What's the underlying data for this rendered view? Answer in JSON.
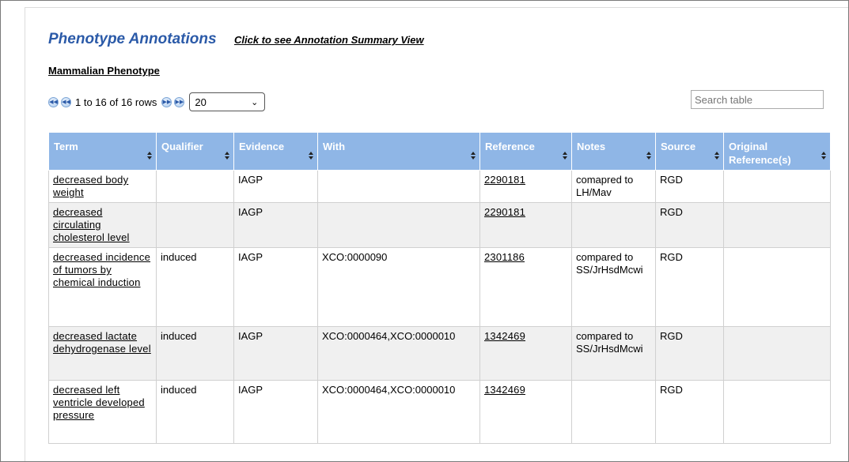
{
  "header": {
    "title": "Phenotype Annotations",
    "summary_link": "Click to see Annotation Summary View"
  },
  "subsection": {
    "title": "Mammalian Phenotype"
  },
  "pager": {
    "rows_text": "1 to 16 of 16 rows",
    "page_size": "20",
    "icons": [
      "first-page-icon",
      "prev-page-icon",
      "next-page-icon",
      "last-page-icon"
    ]
  },
  "search": {
    "placeholder": "Search table"
  },
  "table": {
    "columns": [
      "Term",
      "Qualifier",
      "Evidence",
      "With",
      "Reference",
      "Notes",
      "Source",
      "Original Reference(s)"
    ],
    "rows": [
      {
        "term": "decreased body weight",
        "qualifier": "",
        "evidence": "IAGP",
        "with": "",
        "reference": "2290181",
        "notes": "comapred to LH/Mav",
        "source": "RGD",
        "original": ""
      },
      {
        "term": "decreased circulating cholesterol level",
        "qualifier": "",
        "evidence": "IAGP",
        "with": "",
        "reference": "2290181",
        "notes": "",
        "source": "RGD",
        "original": ""
      },
      {
        "term": "decreased incidence of tumors by chemical induction",
        "qualifier": "induced",
        "evidence": "IAGP",
        "with": "XCO:0000090",
        "reference": "2301186",
        "notes": "compared to SS/JrHsdMcwi",
        "source": "RGD",
        "original": ""
      },
      {
        "term": "decreased lactate dehydrogenase level",
        "qualifier": "induced",
        "evidence": "IAGP",
        "with": "XCO:0000464,XCO:0000010",
        "reference": "1342469",
        "notes": "compared to SS/JrHsdMcwi",
        "source": "RGD",
        "original": ""
      },
      {
        "term": "decreased left ventricle developed pressure",
        "qualifier": "induced",
        "evidence": "IAGP",
        "with": "XCO:0000464,XCO:0000010",
        "reference": "1342469",
        "notes": "",
        "source": "RGD",
        "original": ""
      }
    ]
  },
  "colors": {
    "title": "#2b5aa8",
    "header_bg": "#8fb6e6",
    "alt_row": "#f0f0f0"
  }
}
